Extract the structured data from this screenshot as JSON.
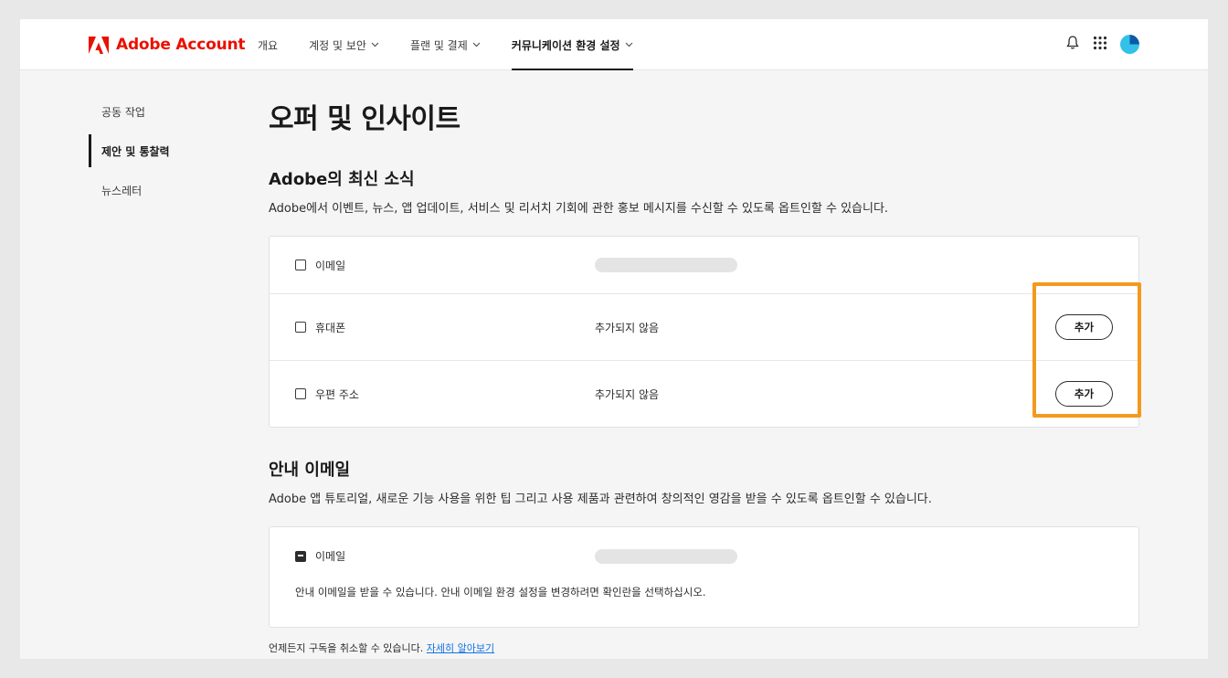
{
  "header": {
    "brand": "Adobe Account",
    "nav": [
      {
        "label": "개요",
        "has_chevron": false,
        "active": false
      },
      {
        "label": "계정 및 보안",
        "has_chevron": true,
        "active": false
      },
      {
        "label": "플랜 및 결제",
        "has_chevron": true,
        "active": false
      },
      {
        "label": "커뮤니케이션 환경 설정",
        "has_chevron": true,
        "active": true
      }
    ],
    "icons": [
      "bell-icon",
      "apps-grid-icon",
      "avatar"
    ]
  },
  "sidebar": {
    "items": [
      {
        "label": "공동 작업",
        "active": false
      },
      {
        "label": "제안 및 통찰력",
        "active": true
      },
      {
        "label": "뉴스레터",
        "active": false
      }
    ]
  },
  "main": {
    "title": "오퍼 및 인사이트",
    "news": {
      "title": "Adobe의 최신 소식",
      "description": "Adobe에서 이벤트, 뉴스, 앱 업데이트, 서비스 및 리서치 기회에 관한 홍보 메시지를 수신할 수 있도록 옵트인할 수 있습니다.",
      "rows": [
        {
          "label": "이메일",
          "value": "",
          "checked": false,
          "button": ""
        },
        {
          "label": "휴대폰",
          "value": "추가되지 않음",
          "checked": false,
          "button": "추가"
        },
        {
          "label": "우편 주소",
          "value": "추가되지 않음",
          "checked": false,
          "button": "추가"
        }
      ]
    },
    "guide": {
      "title": "안내 이메일",
      "description": "Adobe 앱 튜토리얼, 새로운 기능 사용을 위한 팁 그리고 사용 제품과 관련하여 창의적인 영감을 받을 수 있도록 옵트인할 수 있습니다.",
      "row": {
        "label": "이메일",
        "state": "indeterminate"
      },
      "note": "안내 이메일을 받을 수 있습니다. 안내 이메일 환경 설정을 변경하려면 확인란을 선택하십시오."
    },
    "footer": {
      "text": "언제든지 구독을 취소할 수 있습니다.",
      "link": "자세히 알아보기"
    }
  },
  "colors": {
    "brand_red": "#eb1000",
    "highlight_orange": "#f39a1e",
    "link_blue": "#1473e6"
  }
}
